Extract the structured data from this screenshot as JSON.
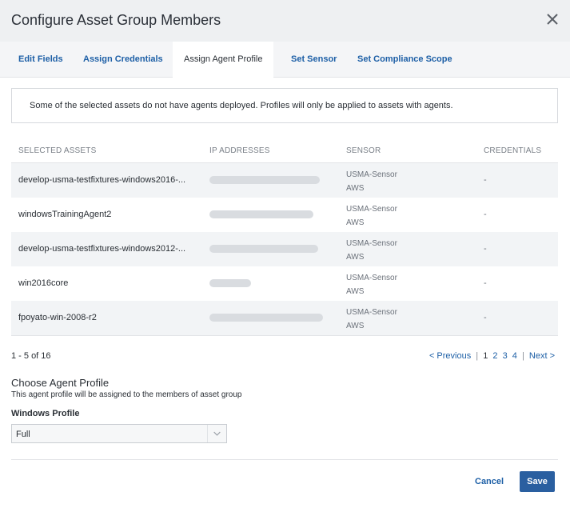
{
  "dialog": {
    "title": "Configure Asset Group Members"
  },
  "tabs": [
    {
      "label": "Edit Fields",
      "active": false
    },
    {
      "label": "Assign Credentials",
      "active": false
    },
    {
      "label": "Assign Agent Profile",
      "active": true
    },
    {
      "label": "Set Sensor",
      "active": false
    },
    {
      "label": "Set Compliance Scope",
      "active": false
    }
  ],
  "notice": "Some of the selected assets do not have agents deployed. Profiles will only be applied to assets with agents.",
  "table": {
    "columns": [
      "SELECTED ASSETS",
      "IP ADDRESSES",
      "SENSOR",
      "CREDENTIALS"
    ],
    "rows": [
      {
        "name": "develop-usma-testfixtures-windows2016-...",
        "ip": "",
        "sensor_line1": "USMA-Sensor",
        "sensor_line2": "AWS",
        "credentials": "-"
      },
      {
        "name": "windowsTrainingAgent2",
        "ip": "",
        "sensor_line1": "USMA-Sensor",
        "sensor_line2": "AWS",
        "credentials": "-"
      },
      {
        "name": "develop-usma-testfixtures-windows2012-...",
        "ip": "",
        "sensor_line1": "USMA-Sensor",
        "sensor_line2": "AWS",
        "credentials": "-"
      },
      {
        "name": "win2016core",
        "ip": "",
        "sensor_line1": "USMA-Sensor",
        "sensor_line2": "AWS",
        "credentials": "-"
      },
      {
        "name": "fpoyato-win-2008-r2",
        "ip": "",
        "sensor_line1": "USMA-Sensor",
        "sensor_line2": "AWS",
        "credentials": "-"
      }
    ]
  },
  "pagination": {
    "range": "1 - 5 of 16",
    "previous": "< Previous",
    "separator": "|",
    "pages": [
      "1",
      "2",
      "3",
      "4"
    ],
    "current_page": "1",
    "next": "Next >"
  },
  "agent_profile": {
    "section_title": "Choose Agent Profile",
    "description": "This agent profile will be assigned to the members of asset group",
    "field_label": "Windows Profile",
    "selected_value": "Full"
  },
  "footer": {
    "cancel_label": "Cancel",
    "save_label": "Save"
  },
  "icons": {
    "close": "close-icon",
    "select_caret": "chevron-down-icon"
  },
  "colors": {
    "accent": "#1d5fa6",
    "save_button": "#2a5fa0",
    "header_bg": "#eef0f2"
  }
}
